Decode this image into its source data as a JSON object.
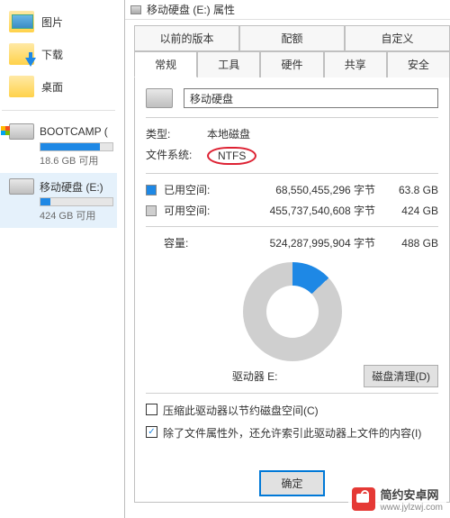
{
  "sidebar": {
    "folders": [
      {
        "label": "图片"
      },
      {
        "label": "下载"
      },
      {
        "label": "桌面"
      }
    ],
    "drives": [
      {
        "name": "BOOTCAMP (",
        "sub": "18.6 GB 可用",
        "fillPct": 82,
        "selected": false,
        "win": true
      },
      {
        "name": "移动硬盘 (E:)",
        "sub": "424 GB 可用",
        "fillPct": 14,
        "selected": true,
        "win": false
      }
    ]
  },
  "dialog": {
    "title": "移动硬盘 (E:) 属性",
    "tabsTop": [
      "以前的版本",
      "配额",
      "自定义"
    ],
    "tabsBottom": [
      "常规",
      "工具",
      "硬件",
      "共享",
      "安全"
    ],
    "activeTab": "常规",
    "nameField": "移动硬盘",
    "typeLabel": "类型:",
    "typeValue": "本地磁盘",
    "fsLabel": "文件系统:",
    "fsValue": "NTFS",
    "usedLabel": "已用空间:",
    "usedBytes": "68,550,455,296 字节",
    "usedGB": "63.8 GB",
    "freeLabel": "可用空间:",
    "freeBytes": "455,737,540,608 字节",
    "freeGB": "424 GB",
    "capLabel": "容量:",
    "capBytes": "524,287,995,904 字节",
    "capGB": "488 GB",
    "driveLabel": "驱动器 E:",
    "cleanupBtn": "磁盘清理(D)",
    "compressLabel": "压缩此驱动器以节约磁盘空间(C)",
    "indexLabel": "除了文件属性外，还允许索引此驱动器上文件的内容(I)",
    "compressChecked": false,
    "indexChecked": true,
    "okBtn": "确定"
  },
  "watermark": {
    "line1": "简约安卓网",
    "line2": "www.jylzwj.com"
  }
}
